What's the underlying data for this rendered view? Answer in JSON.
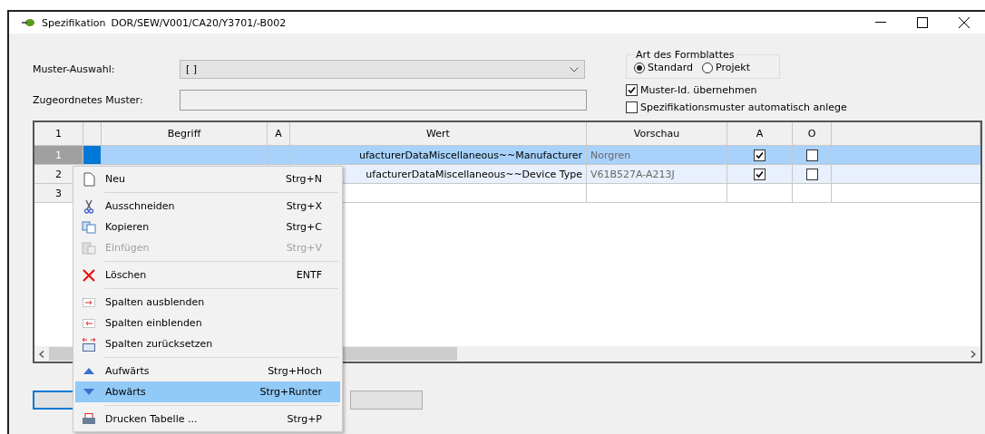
{
  "window": {
    "title": "Spezifikation",
    "path": "DOR/SEW/V001/CA20/Y3701/-B002"
  },
  "form": {
    "muster_auswahl": {
      "label": "Muster-Auswahl:",
      "value": "[ ]"
    },
    "zugeordnetes_muster": {
      "label": "Zugeordnetes Muster:"
    }
  },
  "art_des_formblattes": {
    "title": "Art des Formblattes",
    "options": [
      {
        "label": "Standard",
        "selected": true
      },
      {
        "label": "Projekt",
        "selected": false
      }
    ]
  },
  "checkboxes": [
    {
      "label": "Muster-Id. übernehmen",
      "checked": true
    },
    {
      "label": "Spezifikationsmuster automatisch anlege",
      "checked": false
    }
  ],
  "table": {
    "corner": "1",
    "columns": [
      "Begriff",
      "A",
      "Wert",
      "Vorschau",
      "A",
      "O"
    ],
    "rows": [
      {
        "number": "1",
        "selected": true,
        "kind": "data",
        "wert": "ufacturerDataMiscellaneous~~Manufacturer",
        "vorschau": "Norgren",
        "a": true,
        "o": false
      },
      {
        "number": "2",
        "selected": false,
        "kind": "data",
        "wert": "ufacturerDataMiscellaneous~~Device Type",
        "vorschau": "V61B527A-A213J",
        "a": true,
        "o": false
      },
      {
        "number": "3",
        "selected": false,
        "kind": "empty"
      }
    ]
  },
  "context_menu": [
    {
      "kind": "item",
      "label": "Neu",
      "shortcut": "Strg+N",
      "disabled": false,
      "selected": false
    },
    {
      "kind": "separator"
    },
    {
      "kind": "item",
      "label": "Ausschneiden",
      "shortcut": "Strg+X",
      "disabled": false,
      "selected": false
    },
    {
      "kind": "item",
      "label": "Kopieren",
      "shortcut": "Strg+C",
      "disabled": false,
      "selected": false
    },
    {
      "kind": "item",
      "label": "Einfügen",
      "shortcut": "Strg+V",
      "disabled": true,
      "selected": false
    },
    {
      "kind": "separator"
    },
    {
      "kind": "item",
      "label": "Löschen",
      "shortcut": "ENTF",
      "disabled": false,
      "selected": false
    },
    {
      "kind": "separator"
    },
    {
      "kind": "item",
      "label": "Spalten ausblenden",
      "disabled": false,
      "selected": false
    },
    {
      "kind": "item",
      "label": "Spalten einblenden",
      "disabled": false,
      "selected": false
    },
    {
      "kind": "item",
      "label": "Spalten zurücksetzen",
      "disabled": false,
      "selected": false
    },
    {
      "kind": "separator"
    },
    {
      "kind": "item",
      "label": "Aufwärts",
      "shortcut": "Strg+Hoch",
      "disabled": false,
      "selected": false
    },
    {
      "kind": "item",
      "label": "Abwärts",
      "shortcut": "Strg+Runter",
      "disabled": false,
      "selected": true
    },
    {
      "kind": "separator"
    },
    {
      "kind": "item",
      "label": "Drucken Tabelle ...",
      "shortcut": "Strg+P",
      "disabled": false,
      "selected": false
    }
  ]
}
